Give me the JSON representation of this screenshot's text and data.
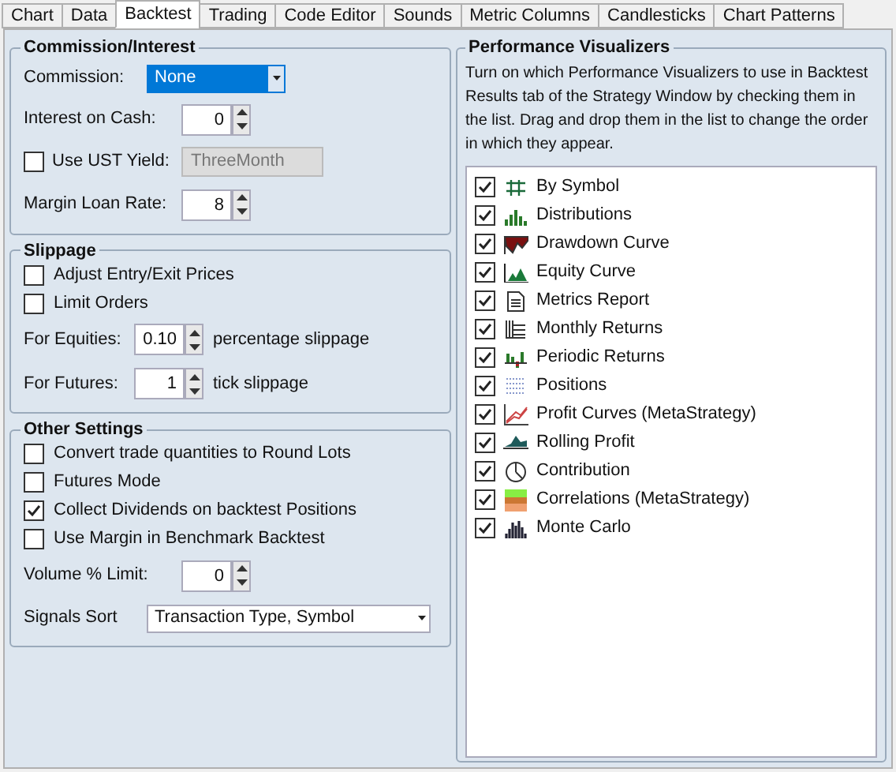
{
  "tabs": [
    {
      "label": "Chart",
      "selected": false
    },
    {
      "label": "Data",
      "selected": false
    },
    {
      "label": "Backtest",
      "selected": true
    },
    {
      "label": "Trading",
      "selected": false
    },
    {
      "label": "Code Editor",
      "selected": false
    },
    {
      "label": "Sounds",
      "selected": false
    },
    {
      "label": "Metric Columns",
      "selected": false
    },
    {
      "label": "Candlesticks",
      "selected": false
    },
    {
      "label": "Chart Patterns",
      "selected": false
    }
  ],
  "sections": [
    {
      "title": "Commission/Interest",
      "rows": [
        {
          "kind": "dropdown",
          "label": "Commission:",
          "value": "None",
          "focused": true
        },
        {
          "kind": "spinner",
          "label": "Interest on Cash:",
          "value": "0"
        },
        {
          "kind": "check_field",
          "label": "Use UST Yield:",
          "checked": false,
          "value": "ThreeMonth"
        },
        {
          "kind": "spinner",
          "label": "Margin Loan Rate:",
          "value": "8"
        }
      ]
    },
    {
      "title": "Slippage",
      "rows": [
        {
          "kind": "checkbox",
          "label": "Adjust Entry/Exit Prices",
          "checked": false
        },
        {
          "kind": "checkbox",
          "label": "Limit Orders",
          "checked": false
        },
        {
          "kind": "spinner",
          "label": "For Equities:",
          "value": "0.10",
          "suffix": "percentage slippage"
        },
        {
          "kind": "spinner",
          "label": "For Futures:",
          "value": "1",
          "suffix": "tick slippage"
        }
      ]
    },
    {
      "title": "Other Settings",
      "rows": [
        {
          "kind": "checkbox",
          "label": "Convert trade quantities to Round Lots",
          "checked": false
        },
        {
          "kind": "checkbox",
          "label": "Futures Mode",
          "checked": false
        },
        {
          "kind": "checkbox",
          "label": "Collect Dividends on backtest Positions",
          "checked": true
        },
        {
          "kind": "checkbox",
          "label": "Use Margin in Benchmark Backtest",
          "checked": false
        },
        {
          "kind": "spinner",
          "label": "Volume % Limit:",
          "value": "0"
        },
        {
          "kind": "dropdown",
          "label": "Signals Sort",
          "value": "Transaction Type, Symbol",
          "focused": false
        }
      ]
    }
  ],
  "visualizers": {
    "title": "Performance Visualizers",
    "description": "Turn on which Performance Visualizers to use in Backtest Results tab of the Strategy Window by checking them in the list. Drag and drop them in the list to change the order in which they appear.",
    "items": [
      {
        "label": "By Symbol",
        "checked": true
      },
      {
        "label": "Distributions",
        "checked": true
      },
      {
        "label": "Drawdown Curve",
        "checked": true
      },
      {
        "label": "Equity Curve",
        "checked": true
      },
      {
        "label": "Metrics Report",
        "checked": true
      },
      {
        "label": "Monthly Returns",
        "checked": true
      },
      {
        "label": "Periodic Returns",
        "checked": true
      },
      {
        "label": "Positions",
        "checked": true
      },
      {
        "label": "Profit Curves (MetaStrategy)",
        "checked": true
      },
      {
        "label": "Rolling Profit",
        "checked": true
      },
      {
        "label": "Contribution",
        "checked": true
      },
      {
        "label": "Correlations (MetaStrategy)",
        "checked": true
      },
      {
        "label": "Monte Carlo",
        "checked": true
      }
    ]
  }
}
